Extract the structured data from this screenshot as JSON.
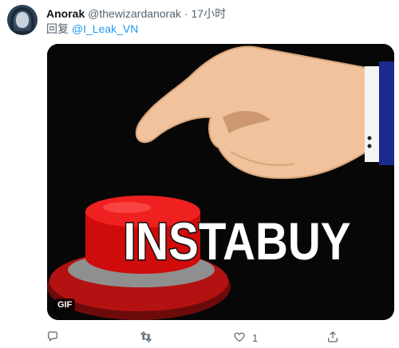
{
  "tweet": {
    "author_name": "Anorak",
    "author_handle": "@thewizardanorak",
    "separator": "·",
    "timestamp": "17小时",
    "reply_prefix": "回复",
    "reply_mention": "@I_Leak_VN",
    "media": {
      "caption_text": "INSTABUY",
      "badge": "GIF"
    },
    "actions": {
      "reply_count": "",
      "retweet_count": "",
      "like_count": "1",
      "share_count": ""
    }
  },
  "icons": {
    "reply": "comment-icon",
    "retweet": "retweet-icon",
    "like": "heart-icon",
    "share": "share-icon"
  },
  "colors": {
    "link": "#1d9bf0",
    "secondary_text": "#536471",
    "button_red": "#e61010",
    "media_bg": "#070707"
  }
}
